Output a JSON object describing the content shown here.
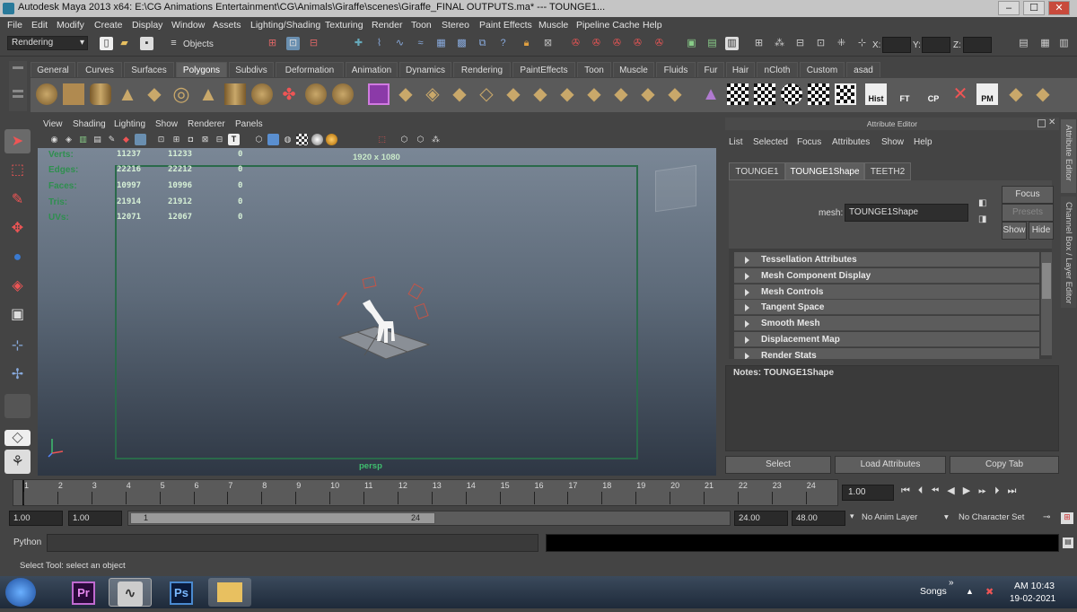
{
  "window": {
    "title": "Autodesk Maya 2013 x64: E:\\CG Animations Entertainment\\CG\\Animals\\Giraffe\\scenes\\Giraffe_FINAL OUTPUTS.ma*   ---   TOUNGE1...",
    "minimize": "–",
    "maximize": "☐",
    "close": "✕"
  },
  "menubar": [
    "File",
    "Edit",
    "Modify",
    "Create",
    "Display",
    "Window",
    "Assets",
    "Lighting/Shading",
    "Texturing",
    "Render",
    "Toon",
    "Stereo",
    "Paint Effects",
    "Muscle",
    "Pipeline Cache",
    "Help"
  ],
  "statusline": {
    "menuset": "Rendering",
    "selection_mode": "Objects",
    "x_label": "X:",
    "y_label": "Y:",
    "z_label": "Z:"
  },
  "shelf": {
    "tabs": [
      "General",
      "Curves",
      "Surfaces",
      "Polygons",
      "Subdivs",
      "Deformation",
      "Animation",
      "Dynamics",
      "Rendering",
      "PaintEffects",
      "Toon",
      "Muscle",
      "Fluids",
      "Fur",
      "Hair",
      "nCloth",
      "Custom",
      "asad"
    ],
    "active": "Polygons",
    "extra_labels": [
      "Hist",
      "FT",
      "CP",
      "PM"
    ]
  },
  "viewport": {
    "menu": [
      "View",
      "Shading",
      "Lighting",
      "Show",
      "Renderer",
      "Panels"
    ],
    "resolution": "1920 x 1080",
    "camera": "persp",
    "hud": [
      {
        "label": "Verts:",
        "a": "11237",
        "b": "11233",
        "c": "0"
      },
      {
        "label": "Edges:",
        "a": "22216",
        "b": "22212",
        "c": "0"
      },
      {
        "label": "Faces:",
        "a": "10997",
        "b": "10996",
        "c": "0"
      },
      {
        "label": "Tris:",
        "a": "21914",
        "b": "21912",
        "c": "0"
      },
      {
        "label": "UVs:",
        "a": "12071",
        "b": "12067",
        "c": "0"
      }
    ]
  },
  "attribute_editor": {
    "header": "Attribute Editor",
    "menu": [
      "List",
      "Selected",
      "Focus",
      "Attributes",
      "Show",
      "Help"
    ],
    "tabs": [
      "TOUNGE1",
      "TOUNGE1Shape",
      "TEETH2"
    ],
    "active_tab": "TOUNGE1Shape",
    "mesh_label": "mesh:",
    "mesh_value": "TOUNGE1Shape",
    "focus": "Focus",
    "presets": "Presets",
    "show": "Show",
    "hide": "Hide",
    "sections": [
      "Tessellation Attributes",
      "Mesh Component Display",
      "Mesh Controls",
      "Tangent Space",
      "Smooth Mesh",
      "Displacement Map",
      "Render Stats"
    ],
    "notes": "Notes:  TOUNGE1Shape",
    "buttons": [
      "Select",
      "Load Attributes",
      "Copy Tab"
    ]
  },
  "sidebar": {
    "attr_tab": "Attribute Editor",
    "channel_tab": "Channel Box / Layer Editor"
  },
  "timeline": {
    "ticks": [
      "1",
      "2",
      "3",
      "4",
      "5",
      "6",
      "7",
      "8",
      "9",
      "10",
      "11",
      "12",
      "13",
      "14",
      "15",
      "16",
      "17",
      "18",
      "19",
      "20",
      "21",
      "22",
      "23",
      "24"
    ],
    "current_frame": "1.00"
  },
  "range": {
    "start": "1.00",
    "playback_start": "1.00",
    "slider_start": "1",
    "slider_end": "24",
    "playback_end": "24.00",
    "end": "48.00",
    "anim_layer": "No Anim Layer",
    "character_set": "No Character Set"
  },
  "command": {
    "language": "Python"
  },
  "help": "Select Tool: select an object",
  "taskbar": {
    "apps": [
      "Pr",
      "Ps"
    ],
    "songs": "Songs",
    "time": "AM 10:43",
    "date": "19-02-2021"
  },
  "colors": {
    "accent": "#c35548",
    "hud_green": "#2f8f4f",
    "gate": "#2a6a4a"
  }
}
